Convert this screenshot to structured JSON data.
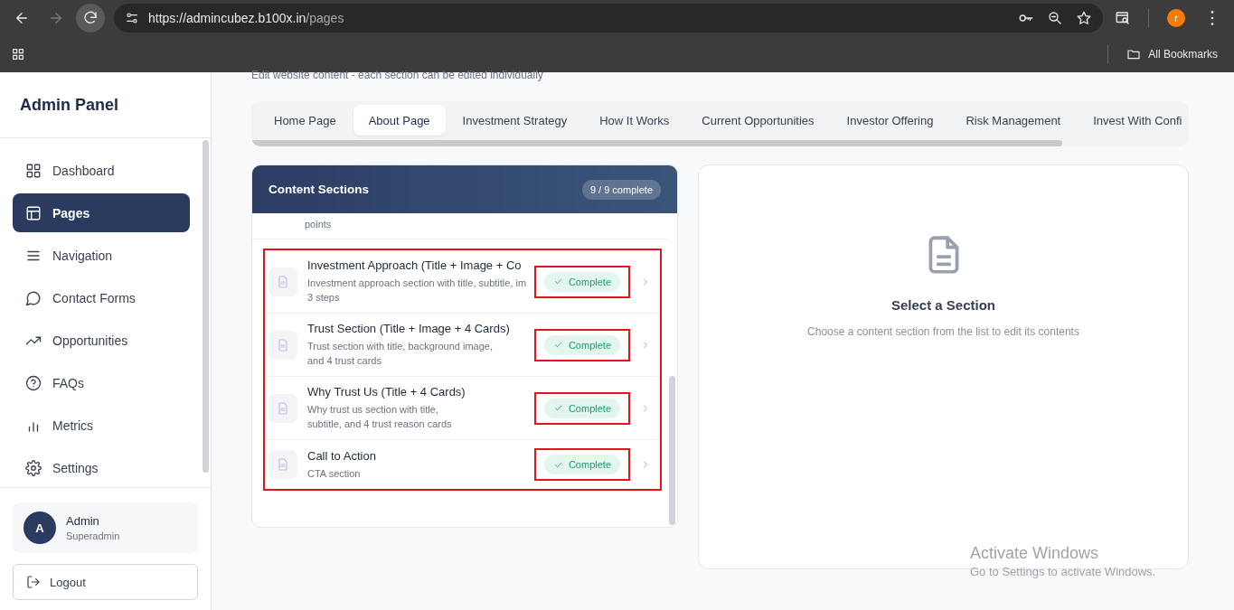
{
  "browser": {
    "url_host": "https://admincubez.b100x.in",
    "url_path": "/pages",
    "forward_disabled": true,
    "profile_initial": "r",
    "bookmarks_label": "All Bookmarks"
  },
  "sidebar": {
    "title": "Admin Panel",
    "items": [
      {
        "label": "Dashboard",
        "selected": false
      },
      {
        "label": "Pages",
        "selected": true
      },
      {
        "label": "Navigation",
        "selected": false
      },
      {
        "label": "Contact Forms",
        "selected": false
      },
      {
        "label": "Opportunities",
        "selected": false
      },
      {
        "label": "FAQs",
        "selected": false
      },
      {
        "label": "Metrics",
        "selected": false
      },
      {
        "label": "Settings",
        "selected": false
      }
    ],
    "user": {
      "initial": "A",
      "name": "Admin",
      "role": "Superadmin"
    },
    "logout": "Logout"
  },
  "page": {
    "subtitle": "Edit website content - each section can be edited individually",
    "tabs": [
      {
        "label": "Home Page",
        "selected": false
      },
      {
        "label": "About Page",
        "selected": true
      },
      {
        "label": "Investment Strategy",
        "selected": false
      },
      {
        "label": "How It Works",
        "selected": false
      },
      {
        "label": "Current Opportunities",
        "selected": false
      },
      {
        "label": "Investor Offering",
        "selected": false
      },
      {
        "label": "Risk Management",
        "selected": false
      },
      {
        "label": "Invest With Confi",
        "selected": false
      }
    ]
  },
  "sections": {
    "title": "Content Sections",
    "count": "9 / 9 complete",
    "group_highlighted": true,
    "items": [
      {
        "kind": "partial",
        "description_lines": [
          "points"
        ]
      },
      {
        "kind": "full",
        "title": "Investment Approach (Title + Image + Co",
        "description_lines": [
          "Investment approach section with title, subtitle, im",
          "3 steps"
        ],
        "status": "Complete",
        "complete": true,
        "highlighted": true
      },
      {
        "kind": "full",
        "title": "Trust Section (Title + Image + 4 Cards)",
        "description_lines": [
          "Trust section with title, background image,",
          "and 4 trust cards"
        ],
        "status": "Complete",
        "complete": true,
        "highlighted": true
      },
      {
        "kind": "full",
        "title": "Why Trust Us (Title + 4 Cards)",
        "description_lines": [
          "Why trust us section with title,",
          "subtitle, and 4 trust reason cards"
        ],
        "status": "Complete",
        "complete": true,
        "highlighted": true
      },
      {
        "kind": "full",
        "title": "Call to Action",
        "description_lines": [
          "CTA section"
        ],
        "status": "Complete",
        "complete": true,
        "highlighted": true
      }
    ]
  },
  "empty_state": {
    "title": "Select a Section",
    "message": "Choose a content section from the list to edit its contents"
  },
  "os_notice": {
    "title": "Activate Windows",
    "subtitle": "Go to Settings to activate Windows."
  }
}
